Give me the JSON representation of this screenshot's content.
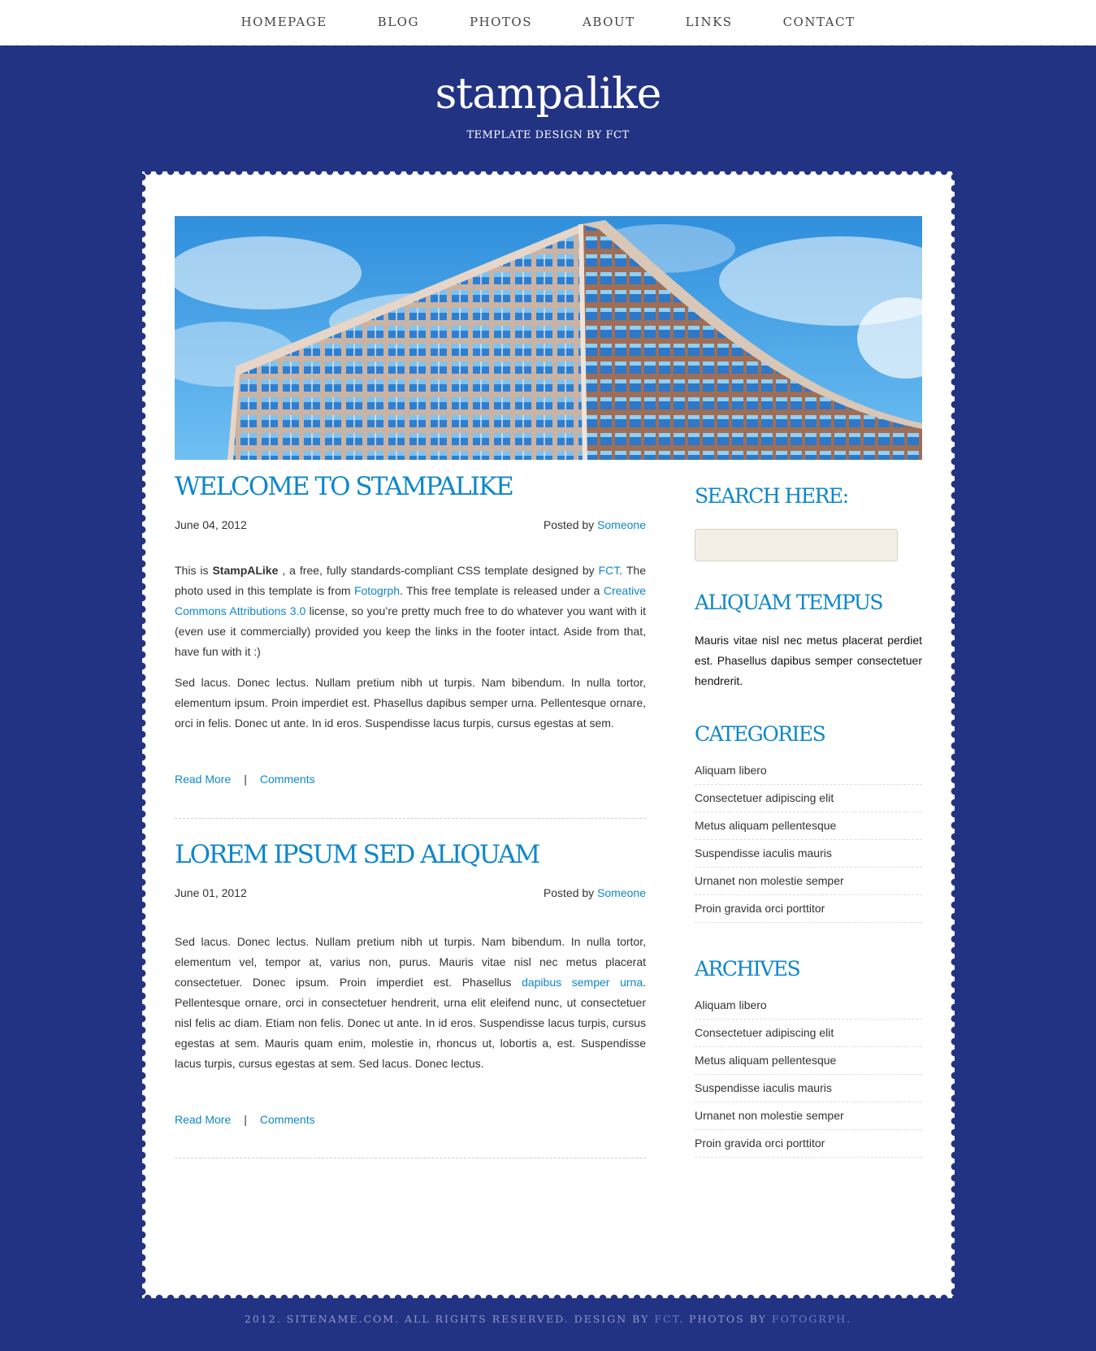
{
  "nav": {
    "items": [
      "HOMEPAGE",
      "BLOG",
      "PHOTOS",
      "ABOUT",
      "LINKS",
      "CONTACT"
    ]
  },
  "header": {
    "title": "stampalike",
    "tagline": "TEMPLATE DESIGN BY FCT"
  },
  "posts": [
    {
      "title": "WELCOME TO STAMPALIKE",
      "date": "June 04, 2012",
      "posted_by_label": "Posted by",
      "author": "Someone",
      "p1": {
        "a": "This is ",
        "b_bold": "StampALike",
        "c": " , a free, fully standards-compliant CSS template designed by ",
        "link1": "FCT",
        "d": ". The photo used in this template is from ",
        "link2": "Fotogrph",
        "e": ". This free template is released under a ",
        "link3": "Creative Commons Attributions 3.0",
        "f": " license, so you’re pretty much free to do whatever you want with it (even use it commercially) provided you keep the links in the footer intact. Aside from that, have fun with it :)"
      },
      "p2": "Sed lacus. Donec lectus. Nullam pretium nibh ut turpis. Nam bibendum. In nulla tortor, elementum ipsum. Proin imperdiet est. Phasellus dapibus semper urna. Pellentesque ornare, orci in felis. Donec ut ante. In id eros. Suspendisse lacus turpis, cursus egestas at sem.",
      "read_more": "Read More",
      "separator": "|",
      "comments": "Comments"
    },
    {
      "title": "LOREM IPSUM SED ALIQUAM",
      "date": "June 01, 2012",
      "posted_by_label": "Posted by",
      "author": "Someone",
      "p1": {
        "a": "Sed lacus. Donec lectus. Nullam pretium nibh ut turpis. Nam bibendum. In nulla tortor, elementum vel, tempor at, varius non, purus. Mauris vitae nisl nec metus placerat consectetuer. Donec ipsum. Proin imperdiet est. Phasellus ",
        "link1": "dapibus semper urna",
        "b": ". Pellentesque ornare, orci in consectetuer hendrerit, urna elit eleifend nunc, ut consectetuer nisl felis ac diam. Etiam non felis. Donec ut ante. In id eros. Suspendisse lacus turpis, cursus egestas at sem. Mauris quam enim, molestie in, rhoncus ut, lobortis a, est. Suspendisse lacus turpis, cursus egestas at sem. Sed lacus. Donec lectus."
      },
      "read_more": "Read More",
      "separator": "|",
      "comments": "Comments"
    }
  ],
  "sidebar": {
    "search_title": "SEARCH HERE:",
    "search_value": "",
    "aliquam_title": "ALIQUAM TEMPUS",
    "aliquam_text": "Mauris vitae nisl nec metus placerat perdiet est. Phasellus dapibus semper consectetuer hendrerit.",
    "categories_title": "CATEGORIES",
    "categories": [
      "Aliquam libero",
      "Consectetuer adipiscing elit",
      "Metus aliquam pellentesque",
      "Suspendisse iaculis mauris",
      "Urnanet non molestie semper",
      "Proin gravida orci porttitor"
    ],
    "archives_title": "ARCHIVES",
    "archives": [
      "Aliquam libero",
      "Consectetuer adipiscing elit",
      "Metus aliquam pellentesque",
      "Suspendisse iaculis mauris",
      "Urnanet non molestie semper",
      "Proin gravida orci porttitor"
    ]
  },
  "footer": {
    "a": "2012. SITENAME.COM. ALL RIGHTS RESERVED. DESIGN BY ",
    "link1": "FCT",
    "b": ". PHOTOS BY ",
    "link2": "FOTOGRPH",
    "c": "."
  },
  "colors": {
    "background": "#233384",
    "accent": "#0d87cc",
    "card": "#ffffff"
  }
}
